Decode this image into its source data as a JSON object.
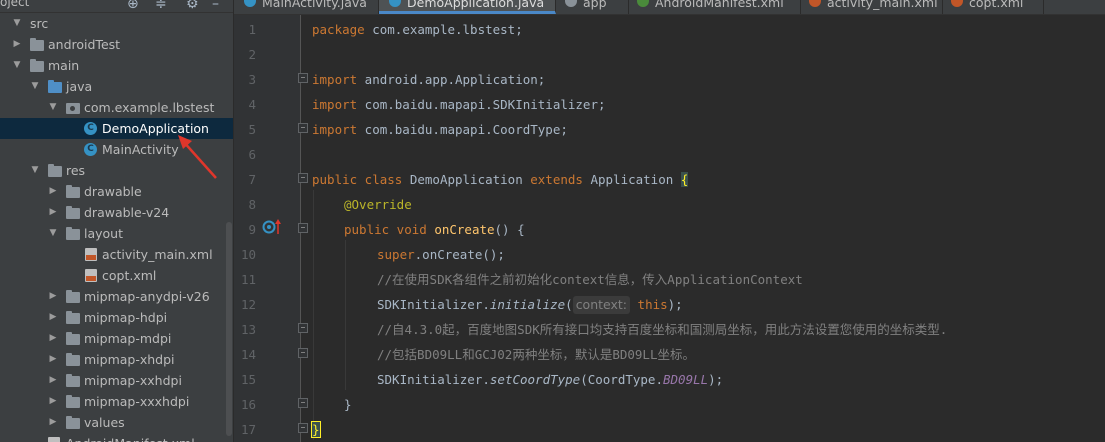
{
  "tree": {
    "header_label": "oject",
    "items": [
      {
        "label": "src",
        "arrow": "down",
        "icon": "folder-icon",
        "folder_color": "grey"
      },
      {
        "label": "androidTest",
        "arrow": "right",
        "icon": "folder-icon",
        "folder_color": "grey"
      },
      {
        "label": "main",
        "arrow": "down",
        "icon": "folder-icon",
        "folder_color": "grey"
      },
      {
        "label": "java",
        "arrow": "down",
        "icon": "source-folder-icon",
        "folder_color": "blue"
      },
      {
        "label": "com.example.lbstest",
        "arrow": "down",
        "icon": "package-icon",
        "folder_color": "grey"
      },
      {
        "label": "DemoApplication",
        "arrow": "",
        "icon": "class-icon",
        "selected": true
      },
      {
        "label": "MainActivity",
        "arrow": "",
        "icon": "class-icon"
      },
      {
        "label": "res",
        "arrow": "down",
        "icon": "resource-folder-icon",
        "folder_color": "grey"
      },
      {
        "label": "drawable",
        "arrow": "right",
        "icon": "folder-icon"
      },
      {
        "label": "drawable-v24",
        "arrow": "right",
        "icon": "folder-icon"
      },
      {
        "label": "layout",
        "arrow": "down",
        "icon": "folder-icon"
      },
      {
        "label": "activity_main.xml",
        "arrow": "",
        "icon": "xml-file-icon"
      },
      {
        "label": "copt.xml",
        "arrow": "",
        "icon": "xml-file-icon"
      },
      {
        "label": "mipmap-anydpi-v26",
        "arrow": "right",
        "icon": "folder-icon"
      },
      {
        "label": "mipmap-hdpi",
        "arrow": "right",
        "icon": "folder-icon"
      },
      {
        "label": "mipmap-mdpi",
        "arrow": "right",
        "icon": "folder-icon"
      },
      {
        "label": "mipmap-xhdpi",
        "arrow": "right",
        "icon": "folder-icon"
      },
      {
        "label": "mipmap-xxhdpi",
        "arrow": "right",
        "icon": "folder-icon"
      },
      {
        "label": "mipmap-xxxhdpi",
        "arrow": "right",
        "icon": "folder-icon"
      },
      {
        "label": "values",
        "arrow": "right",
        "icon": "folder-icon"
      },
      {
        "label": "AndroidManifest.xml",
        "arrow": "",
        "icon": "manifest-file-icon"
      }
    ]
  },
  "tabs": [
    {
      "label": "MainActivity.java",
      "icon": "java-class-icon",
      "active": false
    },
    {
      "label": "DemoApplication.java",
      "icon": "java-class-icon",
      "active": true
    },
    {
      "label": "app",
      "icon": "module-icon",
      "active": false
    },
    {
      "label": "AndroidManifest.xml",
      "icon": "manifest-icon",
      "active": false
    },
    {
      "label": "activity_main.xml",
      "icon": "xml-layout-icon",
      "active": false
    },
    {
      "label": "copt.xml",
      "icon": "xml-layout-icon",
      "active": false
    }
  ],
  "editor": {
    "line_numbers": [
      "1",
      "2",
      "3",
      "4",
      "5",
      "6",
      "7",
      "8",
      "9",
      "10",
      "11",
      "12",
      "13",
      "14",
      "15",
      "16",
      "17"
    ],
    "lines": {
      "l1_kw": "package",
      "l1_rest": " com.example.lbstest;",
      "l3_kw": "import",
      "l3_rest": " android.app.Application;",
      "l4_kw": "import",
      "l4_rest": " com.baidu.mapapi.SDKInitializer;",
      "l5_kw": "import",
      "l5_rest": " com.baidu.mapapi.CoordType;",
      "l7_kw1": "public class",
      "l7_name": " DemoApplication ",
      "l7_kw2": "extends",
      "l7_super": " Application ",
      "l7_brace": "{",
      "l8_ann": "@Override",
      "l9_kw": "public void",
      "l9_fn": " onCreate",
      "l9_rest": "() {",
      "l10_kw": "super",
      "l10_rest": ".onCreate();",
      "l11_cmt": "//在使用SDK各组件之前初始化context信息，传入ApplicationContext",
      "l12_cls": "SDKInitializer.",
      "l12_method": "initialize",
      "l12_open": "(",
      "l12_hint": "context:",
      "l12_this": "this",
      "l12_close": ");",
      "l13_cmt": "//自4.3.0起，百度地图SDK所有接口均支持百度坐标和国测局坐标，用此方法设置您使用的坐标类型.",
      "l14_cmt": "//包括BD09LL和GCJ02两种坐标，默认是BD09LL坐标。",
      "l15_cls": "SDKInitializer.",
      "l15_method": "setCoordType",
      "l15_open": "(CoordType.",
      "l15_const": "BD09LL",
      "l15_close": ");",
      "l16": "}",
      "l17": "}"
    }
  },
  "colors": {
    "keyword": "#cc7832",
    "annotation": "#bbb529",
    "method_decl": "#ffc66d",
    "comment": "#808080",
    "constant": "#9876aa",
    "selection": "#0d293e",
    "annotation_arrow": "#e0362b"
  }
}
